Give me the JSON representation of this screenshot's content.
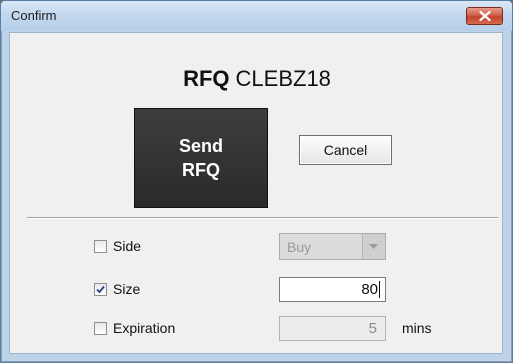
{
  "window": {
    "title": "Confirm",
    "close_icon": "close-icon"
  },
  "header": {
    "prefix": "RFQ",
    "code": "CLEBZ18"
  },
  "buttons": {
    "send_line1": "Send",
    "send_line2": "RFQ",
    "cancel": "Cancel"
  },
  "options": {
    "side": {
      "label": "Side",
      "checked": false,
      "value": "Buy",
      "enabled": false
    },
    "size": {
      "label": "Size",
      "checked": true,
      "value": "80"
    },
    "expiration": {
      "label": "Expiration",
      "checked": false,
      "value": "5",
      "unit": "mins"
    }
  },
  "colors": {
    "send_button": "#2f2f2f",
    "close_button": "#c94a35",
    "window_frame": "#bcd3ea"
  }
}
